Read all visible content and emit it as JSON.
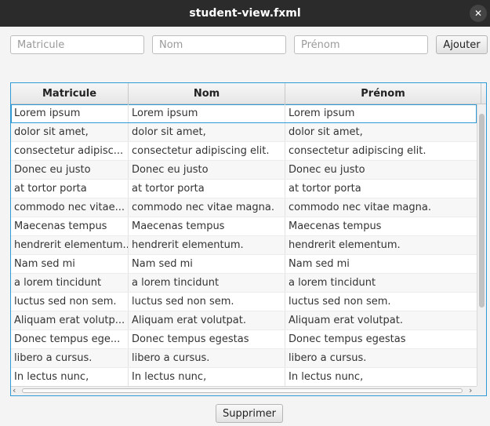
{
  "window": {
    "title": "student-view.fxml",
    "close_glyph": "✕"
  },
  "form": {
    "matricule_placeholder": "Matricule",
    "nom_placeholder": "Nom",
    "prenom_placeholder": "Prénom",
    "add_label": "Ajouter"
  },
  "table": {
    "columns": [
      "Matricule",
      "Nom",
      "Prénom"
    ],
    "rows": [
      [
        "Lorem ipsum",
        "Lorem ipsum",
        "Lorem ipsum"
      ],
      [
        "dolor sit amet,",
        "dolor sit amet,",
        "dolor sit amet,"
      ],
      [
        "consectetur adipisc...",
        "consectetur adipiscing elit.",
        "consectetur adipiscing elit."
      ],
      [
        "Donec eu justo",
        "Donec eu justo",
        "Donec eu justo"
      ],
      [
        "at tortor porta",
        "at tortor porta",
        "at tortor porta"
      ],
      [
        "commodo nec vitae...",
        "commodo nec vitae magna.",
        "commodo nec vitae magna."
      ],
      [
        "Maecenas tempus",
        "Maecenas tempus",
        "Maecenas tempus"
      ],
      [
        "hendrerit elementum...",
        "hendrerit elementum.",
        "hendrerit elementum."
      ],
      [
        "Nam sed mi",
        "Nam sed mi",
        "Nam sed mi"
      ],
      [
        "a lorem tincidunt",
        "a lorem tincidunt",
        "a lorem tincidunt"
      ],
      [
        "luctus sed non sem.",
        "luctus sed non sem.",
        "luctus sed non sem."
      ],
      [
        "Aliquam erat volutp...",
        "Aliquam erat volutpat.",
        "Aliquam erat volutpat."
      ],
      [
        "Donec tempus ege...",
        "Donec tempus egestas",
        "Donec tempus egestas"
      ],
      [
        "libero a cursus.",
        "libero a cursus.",
        "libero a cursus."
      ],
      [
        "In lectus nunc,",
        "In lectus nunc,",
        "In lectus nunc,"
      ]
    ],
    "selected_row": 0
  },
  "actions": {
    "delete_label": "Supprimer"
  },
  "colors": {
    "accent": "#2f9ad6",
    "titlebar": "#2b2b2b"
  }
}
